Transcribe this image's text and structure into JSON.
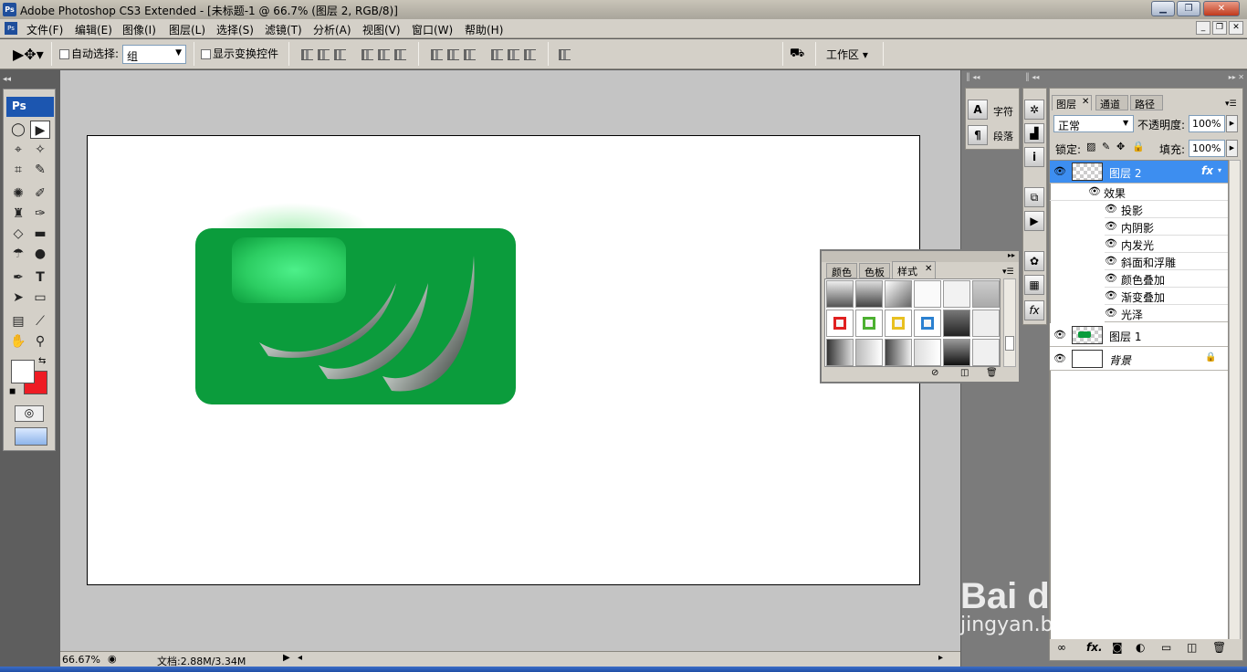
{
  "window": {
    "title": "Adobe Photoshop CS3 Extended - [未标题-1 @ 66.7% (图层 2, RGB/8)]",
    "app_icon": "Ps"
  },
  "menu": {
    "items": [
      "文件(F)",
      "编辑(E)",
      "图像(I)",
      "图层(L)",
      "选择(S)",
      "滤镜(T)",
      "分析(A)",
      "视图(V)",
      "窗口(W)",
      "帮助(H)"
    ]
  },
  "options": {
    "auto_select_label": "自动选择:",
    "auto_select_value": "组",
    "show_transform_label": "显示变换控件",
    "workspace_label": "工作区 ▾"
  },
  "toolbox": {
    "logo": "Ps"
  },
  "status": {
    "zoom": "66.67%",
    "doc_info": "文档:2.88M/3.34M"
  },
  "char_panel": {
    "char_label": "字符",
    "para_label": "段落"
  },
  "styles_panel": {
    "tabs": [
      "颜色",
      "色板",
      "样式"
    ],
    "active_tab": "样式"
  },
  "layers_panel": {
    "tabs": [
      "图层",
      "通道",
      "路径"
    ],
    "blend_mode": "正常",
    "opacity_label": "不透明度:",
    "opacity_value": "100%",
    "lock_label": "锁定:",
    "fill_label": "填充:",
    "fill_value": "100%",
    "layers": [
      {
        "name": "图层 2",
        "fx": "fx",
        "selected": true
      },
      {
        "name": "图层 1",
        "selected": false
      },
      {
        "name": "背景",
        "selected": false
      }
    ],
    "effects_label": "效果",
    "effects": [
      "投影",
      "内阴影",
      "内发光",
      "斜面和浮雕",
      "颜色叠加",
      "渐变叠加",
      "光泽"
    ]
  },
  "watermark": {
    "brand": "Bai du 经验",
    "url": "jingyan.baidu.com"
  },
  "colors": {
    "foreground": "#ffffff",
    "background": "#ee1c24",
    "shape_fill": "#0b9c3c",
    "selected_layer": "#3d8ef0"
  }
}
